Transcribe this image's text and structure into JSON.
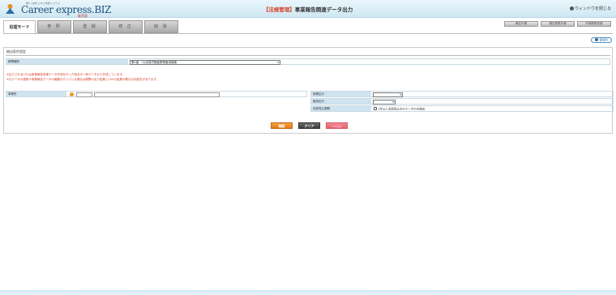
{
  "app": {
    "logo_small": "働く人材ビジネス支援システム",
    "logo_text": "Career express.BIZ",
    "logo_sub": "販売版"
  },
  "header": {
    "menu_category": "【法規管理】",
    "title": "事業報告関連データ出力",
    "close_window": "ウィンドウを閉じる"
  },
  "modes": {
    "label": "処理モード",
    "tabs": [
      "参 照",
      "登 録",
      "修 正",
      "削 除"
    ]
  },
  "top_buttons": [
    "確定外構",
    "確定期限外構",
    "外構期限参照"
  ],
  "usage_button": "使用例",
  "conditions": {
    "title": "抽出条件設定",
    "report_type_label": "帳票種別",
    "report_type_value": "第2面 （1)派遣労働者数等雇用実績",
    "notes": [
      "※出力されるCSVは事業報告書様データ作成を行った時点の一時データから作成しています。",
      "※元データの更新や事業報告データの編集を行っている場合は帳票の出力結果とCSVの結果が異なる可能性があります。"
    ],
    "office_label": "事業所",
    "employment_type_label": "就業区分",
    "hire_type_label": "雇用区分",
    "dispatch_period_label": "派遣見込期間",
    "dispatch_period_check": "1年以上派遣見込みのデータのみ抽出"
  },
  "actions": {
    "confirm": "確認",
    "clear": "クリア",
    "csv": "CSV出力"
  }
}
